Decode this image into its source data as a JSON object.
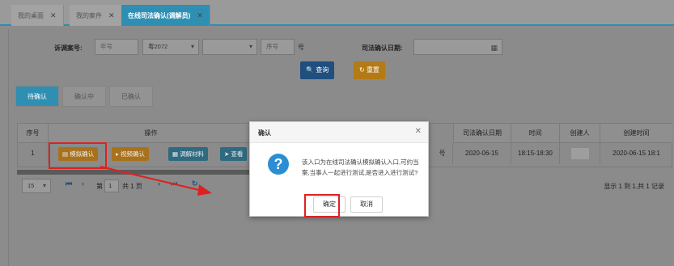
{
  "tabs": [
    {
      "label": "我的桌面",
      "close": "✕"
    },
    {
      "label": "我的案件",
      "close": "✕"
    },
    {
      "label": "在线司法确认(调解员)",
      "close": "✕"
    }
  ],
  "filters": {
    "case_no_label": "诉调案号:",
    "year_placeholder": "年号",
    "court_code": "粤2072",
    "type_value": "",
    "seq_placeholder": "序号",
    "suffix": "号",
    "date_label": "司法确认日期:"
  },
  "buttons": {
    "query": "查询",
    "reset": "重置"
  },
  "subtabs": [
    "待确认",
    "确认中",
    "已确认"
  ],
  "table": {
    "headers": [
      "序号",
      "操作",
      "司法确认日期",
      "时间",
      "创建人",
      "创建时间"
    ],
    "row": {
      "index": "1",
      "ops": [
        "模拟确认",
        "视频确认",
        "调解材料",
        "查看"
      ],
      "case_tail": "号",
      "date": "2020-06-15",
      "time": "18:15-18:30",
      "creator": "",
      "created": "2020-06-15 18:1"
    }
  },
  "pager": {
    "page_size": "15",
    "page_prefix": "第",
    "page_no": "1",
    "page_suffix": "共 1 页",
    "summary": "显示 1 到 1,共 1 记录"
  },
  "modal": {
    "title": "确认",
    "close": "✕",
    "icon": "?",
    "message": "该入口为在线司法确认模拟确认入口,可约当案,当事人一起进行测试,是否进入进行测试?",
    "ok": "确定",
    "cancel": "取消"
  },
  "colors": {
    "accent": "#2f8fb3",
    "query": "#1f4e7f",
    "reset": "#b37a16",
    "highlight": "#e02020",
    "modal_icon": "#2b8ed2"
  }
}
